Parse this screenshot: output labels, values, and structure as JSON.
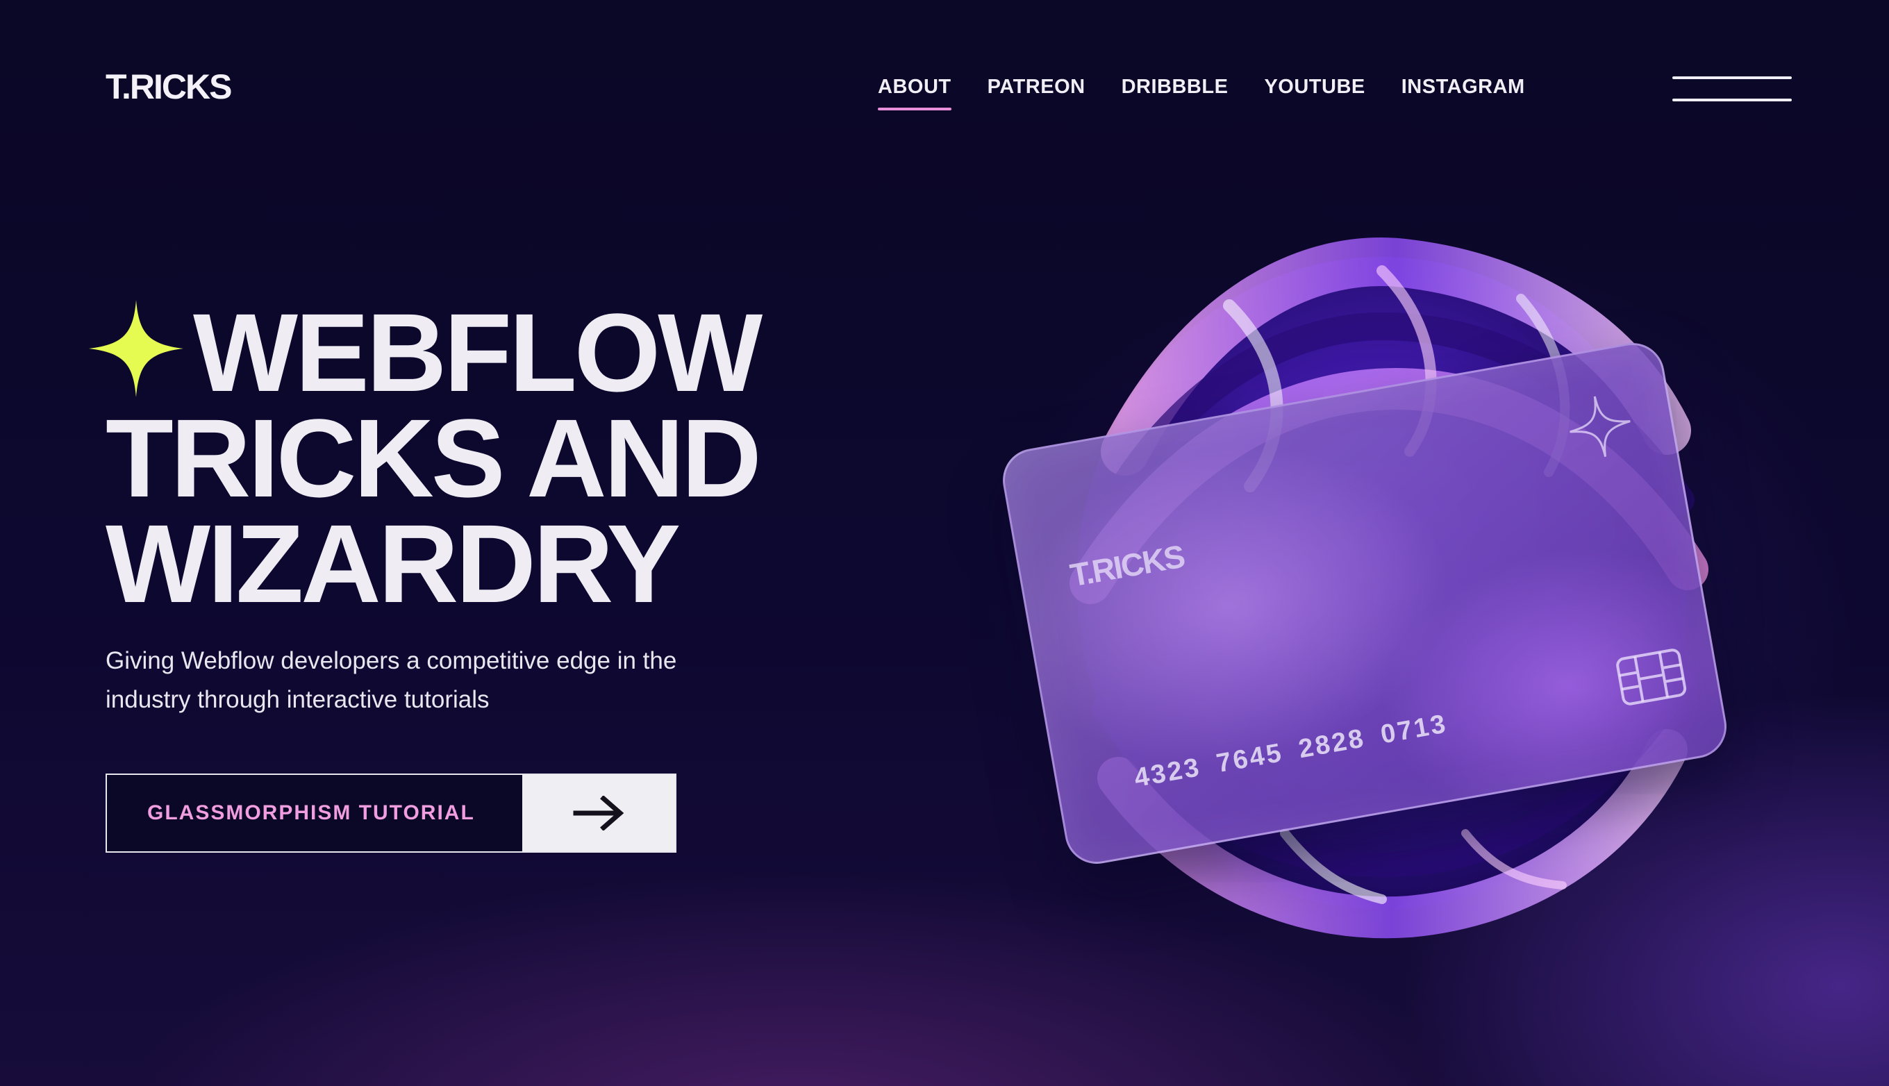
{
  "header": {
    "logo": "T.RICKS",
    "nav": [
      {
        "label": "ABOUT",
        "active": true
      },
      {
        "label": "PATREON",
        "active": false
      },
      {
        "label": "DRIBBBLE",
        "active": false
      },
      {
        "label": "YOUTUBE",
        "active": false
      },
      {
        "label": "INSTAGRAM",
        "active": false
      }
    ],
    "menu_icon": "hamburger-menu-icon"
  },
  "hero": {
    "sparkle_icon": "four-point-star-icon",
    "title_lines": [
      "WEBFLOW",
      "TRICKS AND",
      "WIZARDRY"
    ],
    "subtitle": "Giving Webflow developers a competitive edge in the industry through interactive tutorials",
    "cta": {
      "label": "GLASSMORPHISM TUTORIAL",
      "arrow_icon": "arrow-right-icon"
    }
  },
  "card": {
    "logo": "T.RICKS",
    "number": "4323 7645 2828 0713",
    "star_icon": "sparkle-outline-icon",
    "chip_icon": "card-chip-icon"
  },
  "colors": {
    "background": "#0b0726",
    "accent_pink": "#e78fd8",
    "sparkle_yellow": "#e6fb52",
    "text_light": "#efedf3",
    "card_purple": "#7a4fc0"
  }
}
